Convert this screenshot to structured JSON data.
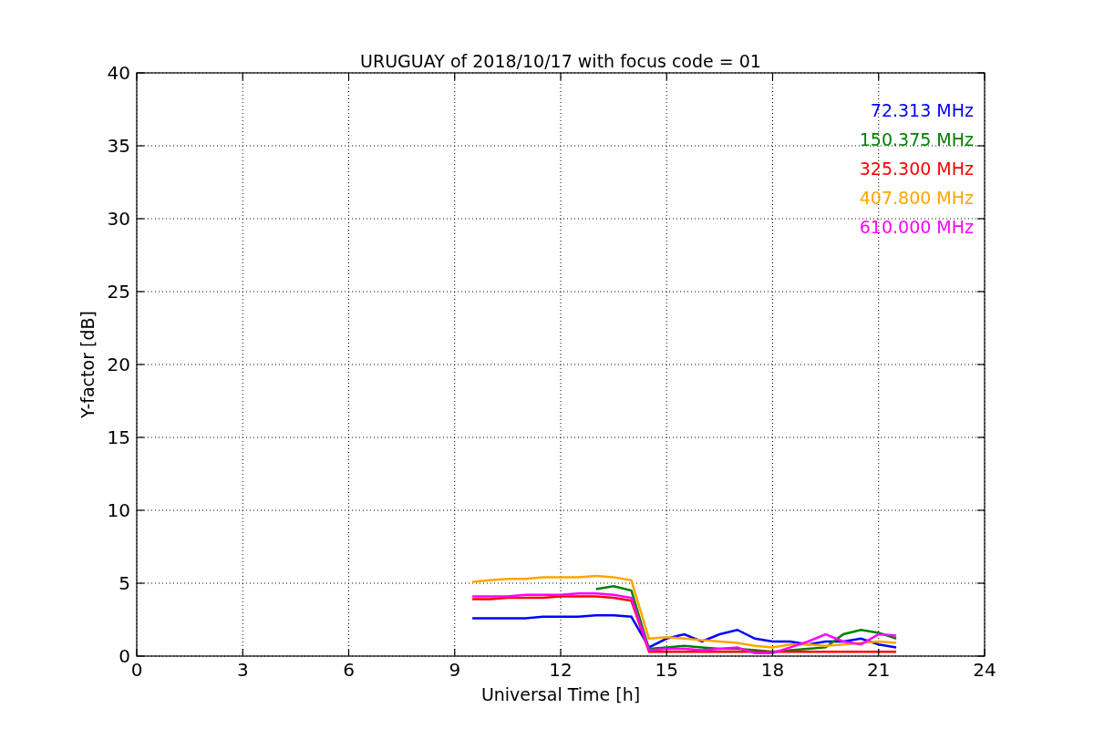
{
  "figure": {
    "chart_data": {
      "type": "line",
      "title": "URUGUAY of 2018/10/17 with focus code = 01",
      "xlabel": "Universal Time [h]",
      "grid": true,
      "ylabel": "Y-factor [dB]",
      "xlim": [
        0,
        24
      ],
      "ylim": [
        0,
        40
      ],
      "xticks": [
        0,
        3,
        6,
        9,
        12,
        15,
        18,
        21,
        24
      ],
      "yticks": [
        0,
        5,
        10,
        15,
        20,
        25,
        30,
        35,
        40
      ],
      "x": [
        9.5,
        10,
        10.5,
        11,
        11.5,
        12,
        12.5,
        13,
        13.5,
        14,
        14.5,
        15,
        15.5,
        16,
        16.5,
        17,
        17.5,
        18,
        18.5,
        19,
        19.5,
        20,
        20.5,
        21,
        21.5
      ],
      "series": [
        {
          "name": "72.313 MHz",
          "color": "#0000ff",
          "values": [
            2.6,
            2.6,
            2.6,
            2.6,
            2.7,
            2.7,
            2.7,
            2.8,
            2.8,
            2.7,
            0.6,
            1.2,
            1.5,
            1.0,
            1.5,
            1.8,
            1.2,
            1.0,
            1.0,
            0.8,
            1.0,
            1.0,
            1.2,
            0.8,
            0.6
          ]
        },
        {
          "name": "150.375 MHz",
          "color": "#008000",
          "values": [
            null,
            null,
            null,
            null,
            null,
            null,
            null,
            4.6,
            4.8,
            4.5,
            0.5,
            0.6,
            0.7,
            0.6,
            0.5,
            0.5,
            0.4,
            0.3,
            0.4,
            0.5,
            0.6,
            1.5,
            1.8,
            1.6,
            1.2
          ]
        },
        {
          "name": "325.300 MHz",
          "color": "#ff0000",
          "values": [
            3.9,
            3.9,
            4.0,
            4.0,
            4.0,
            4.1,
            4.1,
            4.1,
            4.0,
            3.8,
            0.3,
            0.3,
            0.3,
            0.3,
            0.3,
            0.3,
            0.3,
            0.3,
            0.3,
            0.3,
            0.3,
            0.3,
            0.3,
            0.3,
            0.3
          ]
        },
        {
          "name": "407.800 MHz",
          "color": "#ffa500",
          "values": [
            5.1,
            5.2,
            5.3,
            5.3,
            5.4,
            5.4,
            5.4,
            5.5,
            5.4,
            5.2,
            1.2,
            1.3,
            1.2,
            1.1,
            1.0,
            0.9,
            0.7,
            0.6,
            0.8,
            0.8,
            0.7,
            0.8,
            0.9,
            1.0,
            0.9
          ]
        },
        {
          "name": "610.000 MHz",
          "color": "#ff00ff",
          "values": [
            4.1,
            4.1,
            4.1,
            4.2,
            4.2,
            4.2,
            4.3,
            4.3,
            4.2,
            4.0,
            0.4,
            0.5,
            0.5,
            0.4,
            0.5,
            0.6,
            0.2,
            0.2,
            0.6,
            1.0,
            1.5,
            1.0,
            0.8,
            1.5,
            1.4
          ]
        }
      ]
    }
  }
}
